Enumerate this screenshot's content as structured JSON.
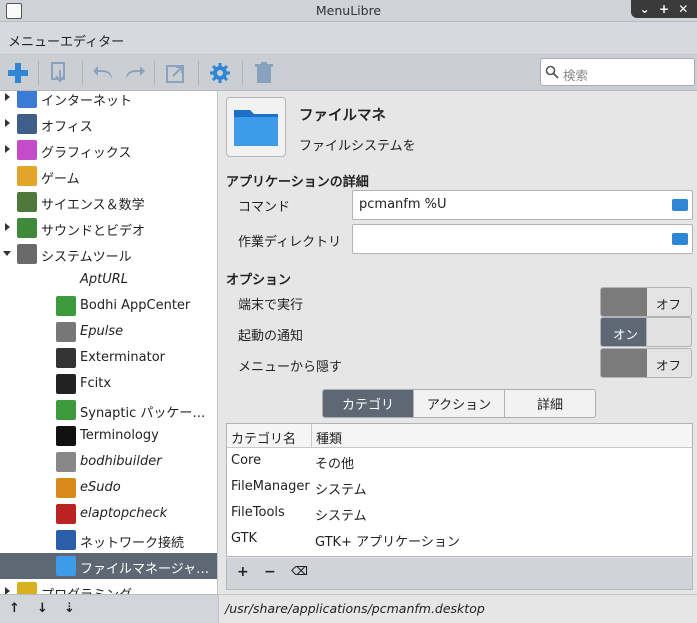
{
  "window": {
    "title": "MenuLibre"
  },
  "header": {
    "title": "メニューエディター"
  },
  "search": {
    "placeholder": "検索"
  },
  "sidebar": {
    "items": [
      {
        "label": "インターネット",
        "icon": "internet-icon",
        "expander": "collapsed",
        "italic": false
      },
      {
        "label": "オフィス",
        "icon": "office-icon",
        "expander": "collapsed",
        "italic": false
      },
      {
        "label": "グラフィックス",
        "icon": "graphics-icon",
        "expander": "collapsed",
        "italic": false
      },
      {
        "label": "ゲーム",
        "icon": "games-icon",
        "expander": "none",
        "italic": false
      },
      {
        "label": "サイエンス＆数学",
        "icon": "science-icon",
        "expander": "none",
        "italic": false
      },
      {
        "label": "サウンドとビデオ",
        "icon": "multimedia-icon",
        "expander": "collapsed",
        "italic": false
      },
      {
        "label": "システムツール",
        "icon": "system-tools-icon",
        "expander": "expanded",
        "italic": false
      },
      {
        "label": "AptURL",
        "icon": "",
        "expander": "none",
        "italic": true
      },
      {
        "label": "Bodhi AppCenter",
        "icon": "package-icon",
        "expander": "none",
        "italic": false
      },
      {
        "label": "Epulse",
        "icon": "epulse-icon",
        "expander": "none",
        "italic": true
      },
      {
        "label": "Exterminator",
        "icon": "monitor-icon",
        "expander": "none",
        "italic": false
      },
      {
        "label": "Fcitx",
        "icon": "penguin-icon",
        "expander": "none",
        "italic": false
      },
      {
        "label": "Synaptic パッケー…",
        "icon": "package-icon",
        "expander": "none",
        "italic": false
      },
      {
        "label": "Terminology",
        "icon": "terminal-icon",
        "expander": "none",
        "italic": false
      },
      {
        "label": "bodhibuilder",
        "icon": "builder-icon",
        "expander": "none",
        "italic": true
      },
      {
        "label": "eSudo",
        "icon": "user-icon",
        "expander": "none",
        "italic": true
      },
      {
        "label": "elaptopcheck",
        "icon": "stop-icon",
        "expander": "none",
        "italic": true
      },
      {
        "label": "ネットワーク接続",
        "icon": "network-icon",
        "expander": "none",
        "italic": false
      },
      {
        "label": "ファイルマネージャ…",
        "icon": "folder-icon",
        "expander": "none",
        "italic": false,
        "selected": true
      },
      {
        "label": "プログラミング",
        "icon": "programming-icon",
        "expander": "collapsed",
        "italic": false
      }
    ]
  },
  "app": {
    "name": "ファイルマネ",
    "comment": "ファイルシステムを",
    "details_header": "アプリケーションの詳細",
    "command_label": "コマンド",
    "command_value": "pcmanfm %U",
    "workdir_label": "作業ディレクトリ",
    "workdir_value": "",
    "options_header": "オプション",
    "options": [
      {
        "label": "端末で実行",
        "state": "オフ",
        "on": false
      },
      {
        "label": "起動の通知",
        "state": "オン",
        "on": true
      },
      {
        "label": "メニューから隠す",
        "state": "オフ",
        "on": false
      }
    ]
  },
  "tabs": [
    {
      "label": "カテゴリ",
      "active": true
    },
    {
      "label": "アクション",
      "active": false
    },
    {
      "label": "詳細",
      "active": false
    }
  ],
  "category_table": {
    "columns": [
      "カテゴリ名",
      "種類"
    ],
    "rows": [
      [
        "Core",
        "その他"
      ],
      [
        "FileManager",
        "システム"
      ],
      [
        "FileTools",
        "システム"
      ],
      [
        "GTK",
        "GTK+ アプリケーション"
      ]
    ]
  },
  "table_toolbar": {
    "add": "+",
    "remove": "−",
    "clear": "⌫"
  },
  "sidebar_toolbar": {
    "up": "↑",
    "down": "↓",
    "sort": "⇣"
  },
  "status": {
    "path": "/usr/share/applications/pcmanfm.desktop"
  },
  "colors": {
    "accent": "#5d6874",
    "add_blue": "#2f86d4",
    "toolbar": "#cbcfd4"
  }
}
